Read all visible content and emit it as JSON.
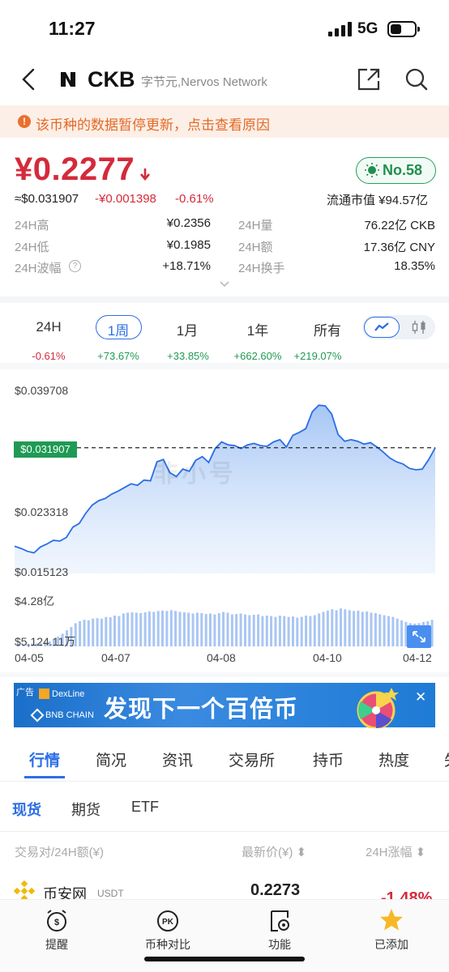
{
  "status": {
    "time": "11:27",
    "network": "5G"
  },
  "nav": {
    "symbol": "CKB",
    "name": "字节元,Nervos Network"
  },
  "notice": {
    "text": "该币种的数据暂停更新，点击查看原因"
  },
  "price": {
    "cny": "¥0.2277",
    "usd": "≈$0.031907",
    "change": "-¥0.001398",
    "change_pct": "-0.61%",
    "rank": "No.58",
    "market_cap": "流通市值 ¥94.57亿"
  },
  "stats": {
    "high_label": "24H高",
    "high": "¥0.2356",
    "low_label": "24H低",
    "low": "¥0.1985",
    "amp_label": "24H波幅",
    "amp": "+18.71%",
    "vol_label": "24H量",
    "vol": "76.22亿 CKB",
    "amount_label": "24H额",
    "amount": "17.36亿 CNY",
    "turnover_label": "24H换手",
    "turnover": "18.35%"
  },
  "periods": [
    {
      "label": "24H",
      "change": "-0.61%"
    },
    {
      "label": "1周",
      "change": "+73.67%"
    },
    {
      "label": "1月",
      "change": "+33.85%"
    },
    {
      "label": "1年",
      "change": "+662.60%"
    },
    {
      "label": "所有",
      "change": "+219.07%"
    }
  ],
  "colors": {
    "up": "#1f9a54",
    "down": "#d42a3b",
    "accent": "#2b6ee6"
  },
  "chart_labels": {
    "y_max": "$0.039708",
    "y_current": "$0.031907",
    "y_mid": "$0.023318",
    "y_min": "$0.015123",
    "vol_max": "$4.28亿",
    "vol_min": "$5,124.11万",
    "watermark": "非小号"
  },
  "chart_data": {
    "type": "area",
    "x_ticks": [
      "04-05",
      "04-07",
      "04-08",
      "04-10",
      "04-12"
    ],
    "ylim": [
      0.015123,
      0.039708
    ],
    "current": 0.031907,
    "price_series": [
      0.0185,
      0.0182,
      0.0178,
      0.0176,
      0.0184,
      0.0188,
      0.0193,
      0.0192,
      0.0197,
      0.0211,
      0.0216,
      0.023,
      0.0241,
      0.0247,
      0.025,
      0.0256,
      0.026,
      0.0265,
      0.027,
      0.0268,
      0.0275,
      0.0274,
      0.03,
      0.0303,
      0.0285,
      0.028,
      0.029,
      0.0287,
      0.0302,
      0.0307,
      0.0299,
      0.0318,
      0.0327,
      0.0323,
      0.0322,
      0.0318,
      0.0323,
      0.0325,
      0.0322,
      0.0321,
      0.0327,
      0.033,
      0.032,
      0.0336,
      0.034,
      0.0345,
      0.0368,
      0.0377,
      0.0376,
      0.0365,
      0.0337,
      0.0328,
      0.033,
      0.0328,
      0.0324,
      0.0326,
      0.032,
      0.0313,
      0.0305,
      0.03,
      0.0297,
      0.0291,
      0.0289,
      0.029,
      0.0303,
      0.0319
    ],
    "volume_series": [
      0.06,
      0.05,
      0.06,
      0.07,
      0.07,
      0.08,
      0.1,
      0.12,
      0.18,
      0.23,
      0.3,
      0.38,
      0.46,
      0.55,
      0.6,
      0.63,
      0.62,
      0.66,
      0.67,
      0.66,
      0.7,
      0.69,
      0.73,
      0.72,
      0.78,
      0.8,
      0.81,
      0.8,
      0.79,
      0.81,
      0.83,
      0.82,
      0.84,
      0.85,
      0.84,
      0.86,
      0.84,
      0.82,
      0.81,
      0.8,
      0.78,
      0.8,
      0.79,
      0.77,
      0.78,
      0.76,
      0.79,
      0.82,
      0.8,
      0.76,
      0.77,
      0.78,
      0.76,
      0.74,
      0.75,
      0.76,
      0.72,
      0.73,
      0.72,
      0.7,
      0.73,
      0.72,
      0.7,
      0.71,
      0.68,
      0.7,
      0.73,
      0.72,
      0.74,
      0.78,
      0.82,
      0.85,
      0.88,
      0.86,
      0.9,
      0.88,
      0.86,
      0.84,
      0.85,
      0.82,
      0.83,
      0.8,
      0.79,
      0.76,
      0.74,
      0.72,
      0.7,
      0.66,
      0.62,
      0.58,
      0.55,
      0.54,
      0.55,
      0.58,
      0.6,
      0.63
    ]
  },
  "ad": {
    "tag": "广告",
    "brand1": "DexLine",
    "brand2": "BNB CHAIN",
    "slogan": "发现下一个百倍币",
    "close": "✕"
  },
  "sections": [
    "行情",
    "简况",
    "资讯",
    "交易所",
    "持币",
    "热度",
    "失"
  ],
  "subtabs": [
    "现货",
    "期货",
    "ETF"
  ],
  "table_head": {
    "pair": "交易对/24H额(¥)",
    "price": "最新价(¥) ⬍",
    "change": "24H涨幅 ⬍"
  },
  "rows": [
    {
      "exchange": "币安网",
      "quote": "USDT",
      "price": "0.2273",
      "change": "-1.48%"
    }
  ],
  "bottom": [
    {
      "label": "提醒"
    },
    {
      "label": "币种对比"
    },
    {
      "label": "功能"
    },
    {
      "label": "已添加"
    }
  ]
}
